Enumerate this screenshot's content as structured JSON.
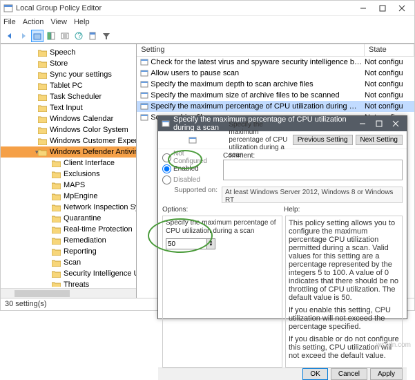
{
  "window": {
    "title": "Local Group Policy Editor",
    "menus": {
      "file": "File",
      "action": "Action",
      "view": "View",
      "help": "Help"
    },
    "status": "30 setting(s)"
  },
  "tree": {
    "items": [
      {
        "label": "Speech"
      },
      {
        "label": "Store"
      },
      {
        "label": "Sync your settings"
      },
      {
        "label": "Tablet PC"
      },
      {
        "label": "Task Scheduler"
      },
      {
        "label": "Text Input"
      },
      {
        "label": "Windows Calendar"
      },
      {
        "label": "Windows Color System"
      },
      {
        "label": "Windows Customer Experience Imp"
      },
      {
        "label": "Windows Defender Antivirus",
        "selected": true,
        "expanded": true
      },
      {
        "label": "Client Interface",
        "child": true
      },
      {
        "label": "Exclusions",
        "child": true
      },
      {
        "label": "MAPS",
        "child": true
      },
      {
        "label": "MpEngine",
        "child": true
      },
      {
        "label": "Network Inspection System",
        "child": true
      },
      {
        "label": "Quarantine",
        "child": true
      },
      {
        "label": "Real-time Protection",
        "child": true
      },
      {
        "label": "Remediation",
        "child": true
      },
      {
        "label": "Reporting",
        "child": true
      },
      {
        "label": "Scan",
        "child": true
      },
      {
        "label": "Security Intelligence Updates",
        "child": true
      },
      {
        "label": "Threats",
        "child": true
      }
    ]
  },
  "list": {
    "columns": {
      "setting": "Setting",
      "state": "State"
    },
    "rows": [
      {
        "setting": "Check for the latest virus and spyware security intelligence b…",
        "state": "Not configu"
      },
      {
        "setting": "Allow users to pause scan",
        "state": "Not configu"
      },
      {
        "setting": "Specify the maximum depth to scan archive files",
        "state": "Not configu"
      },
      {
        "setting": "Specify the maximum size of archive files to be scanned",
        "state": "Not configu"
      },
      {
        "setting": "Specify the maximum percentage of CPU utilization during …",
        "state": "Not configu",
        "selected": true
      },
      {
        "setting": "Scan archive files",
        "state": "Not configu"
      }
    ]
  },
  "dialog": {
    "title": "Specify the maximum percentage of CPU utilization during a scan",
    "subtitle": "Specify the maximum percentage of CPU utilization during a scan",
    "nav": {
      "prev": "Previous Setting",
      "next": "Next Setting"
    },
    "radios": {
      "notconf": "Not Configured",
      "enabled": "Enabled",
      "disabled": "Disabled",
      "value": "enabled"
    },
    "comment_label": "Comment:",
    "supported_label": "Supported on:",
    "supported_text": "At least Windows Server 2012, Windows 8 or Windows RT",
    "options_label": "Options:",
    "help_label": "Help:",
    "option_text": "Specify the maximum percentage of CPU utilization during a scan",
    "option_value": "50",
    "help": {
      "p1": "This policy setting allows you to configure the maximum percentage CPU utilization permitted during a scan. Valid values for this setting are a percentage represented by the integers 5 to 100. A value of 0 indicates that there should be no throttling of CPU utilization. The default value is 50.",
      "p2": "If you enable this setting, CPU utilization will not exceed the percentage specified.",
      "p3": "If you disable or do not configure this setting, CPU utilization will not exceed the default value."
    },
    "buttons": {
      "ok": "OK",
      "cancel": "Cancel",
      "apply": "Apply"
    }
  },
  "watermark": "wsxdn.com"
}
